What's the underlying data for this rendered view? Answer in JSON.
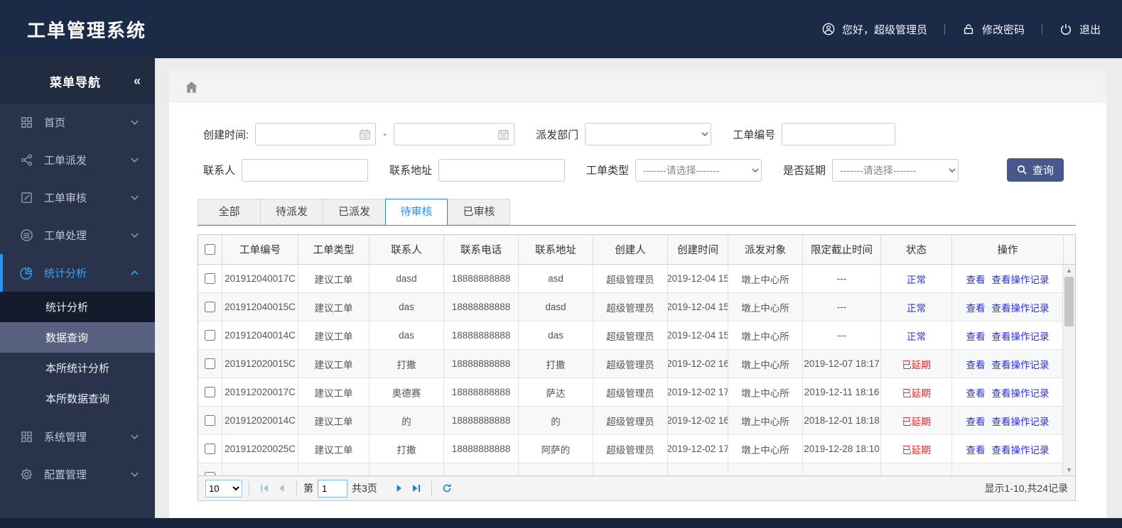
{
  "header": {
    "title": "工单管理系统",
    "greeting": "您好，超级管理员",
    "change_password": "修改密码",
    "logout": "退出"
  },
  "sidebar": {
    "title": "菜单导航",
    "collapse_glyph": "«",
    "items": [
      {
        "label": "首页"
      },
      {
        "label": "工单派发"
      },
      {
        "label": "工单审核"
      },
      {
        "label": "工单处理"
      },
      {
        "label": "统计分析",
        "active": true
      },
      {
        "label": "系统管理"
      },
      {
        "label": "配置管理"
      }
    ],
    "submenu": [
      {
        "label": "统计分析"
      },
      {
        "label": "数据查询",
        "selected": true
      },
      {
        "label": "本所统计分析"
      },
      {
        "label": "本所数据查询"
      }
    ]
  },
  "filters": {
    "create_time_label": "创建时间:",
    "range_separator": "-",
    "dispatch_dept_label": "派发部门",
    "order_no_label": "工单编号",
    "contact_label": "联系人",
    "address_label": "联系地址",
    "order_type_label": "工单类型",
    "delay_label": "是否延期",
    "select_placeholder": "-------请选择-------",
    "search_button": "查询"
  },
  "tabs": {
    "labels": [
      "全部",
      "待派发",
      "已派发",
      "待审核",
      "已审核"
    ],
    "active_index": 3
  },
  "table": {
    "columns": [
      "工单编号",
      "工单类型",
      "联系人",
      "联系电话",
      "联系地址",
      "创建人",
      "创建时间",
      "派发对象",
      "限定截止时间",
      "状态",
      "操作"
    ],
    "action_labels": {
      "view": "查看",
      "view_log": "查看操作记录"
    },
    "rows": [
      {
        "order_no": "201912040017C",
        "type": "建议工单",
        "contact": "dasd",
        "phone": "18888888888",
        "address": "asd",
        "creator": "超级管理员",
        "created": "2019-12-04 15",
        "target": "墩上中心所",
        "deadline": "---",
        "status": "正常",
        "delayed": false
      },
      {
        "order_no": "201912040015C",
        "type": "建议工单",
        "contact": "das",
        "phone": "18888888888",
        "address": "dasd",
        "creator": "超级管理员",
        "created": "2019-12-04 15",
        "target": "墩上中心所",
        "deadline": "---",
        "status": "正常",
        "delayed": false
      },
      {
        "order_no": "201912040014C",
        "type": "建议工单",
        "contact": "das",
        "phone": "18888888888",
        "address": "das",
        "creator": "超级管理员",
        "created": "2019-12-04 15",
        "target": "墩上中心所",
        "deadline": "---",
        "status": "正常",
        "delayed": false
      },
      {
        "order_no": "201912020015C",
        "type": "建议工单",
        "contact": "打撒",
        "phone": "18888888888",
        "address": "打撒",
        "creator": "超级管理员",
        "created": "2019-12-02 16",
        "target": "墩上中心所",
        "deadline": "2019-12-07 18:17",
        "status": "已延期",
        "delayed": true
      },
      {
        "order_no": "201912020017C",
        "type": "建议工单",
        "contact": "奥德赛",
        "phone": "18888888888",
        "address": "萨达",
        "creator": "超级管理员",
        "created": "2019-12-02 17",
        "target": "墩上中心所",
        "deadline": "2019-12-11 18:16",
        "status": "已延期",
        "delayed": true
      },
      {
        "order_no": "201912020014C",
        "type": "建议工单",
        "contact": "的",
        "phone": "18888888888",
        "address": "的",
        "creator": "超级管理员",
        "created": "2019-12-02 16",
        "target": "墩上中心所",
        "deadline": "2018-12-01 18:18",
        "status": "已延期",
        "delayed": true
      },
      {
        "order_no": "201912020025C",
        "type": "建议工单",
        "contact": "打撒",
        "phone": "18888888888",
        "address": "阿萨的",
        "creator": "超级管理员",
        "created": "2019-12-02 17",
        "target": "墩上中心所",
        "deadline": "2019-12-28 18:10",
        "status": "已延期",
        "delayed": true
      }
    ]
  },
  "pagination": {
    "page_size": "10",
    "page_prefix": "第",
    "page": "1",
    "page_total": "共3页",
    "summary": "显示1-10,共24记录"
  },
  "colors": {
    "header_navy": "#1b2a47",
    "sidebar_slate": "#29344c",
    "accent_blue": "#2d8cf0",
    "link_blue": "#2a2fd6",
    "status_red": "#e02b2b",
    "search_button": "#49588a"
  }
}
